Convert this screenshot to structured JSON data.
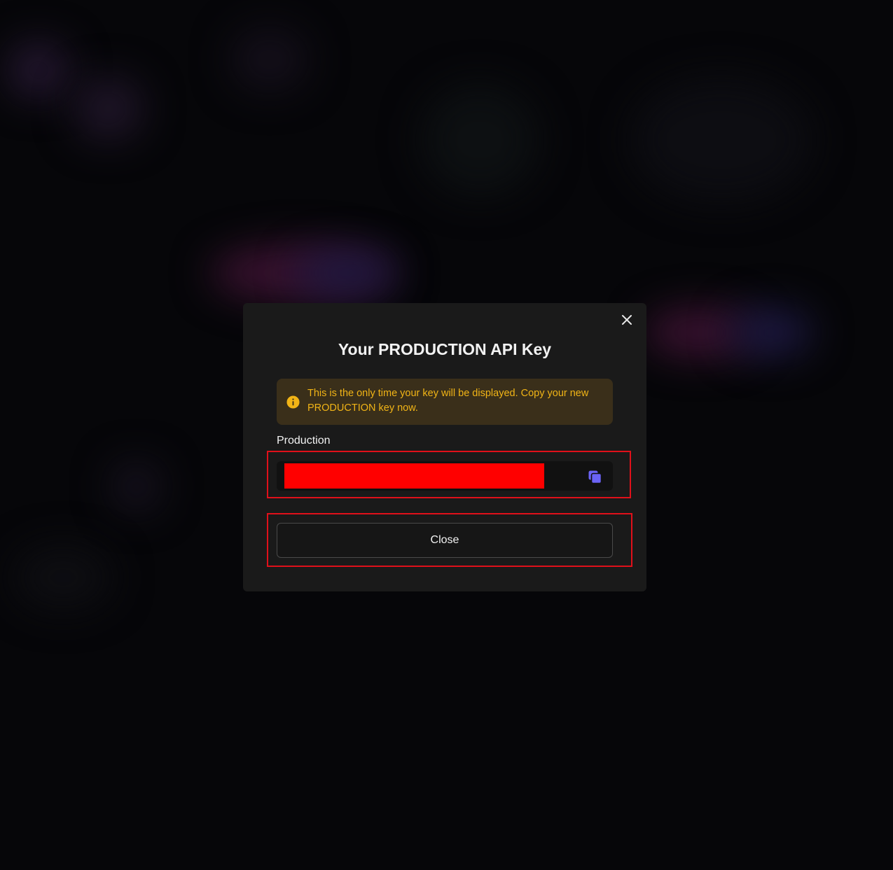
{
  "modal": {
    "title": "Your PRODUCTION API Key",
    "close_icon": "close-icon",
    "warning": {
      "icon": "info-icon",
      "text": "This is the only time your key will be displayed. Copy your new PRODUCTION key now."
    },
    "field": {
      "label": "Production",
      "value": "",
      "copy_icon": "copy-icon"
    },
    "close_button_label": "Close"
  },
  "colors": {
    "modal_bg": "#1a1a1a",
    "warning_bg": "#3a2f1a",
    "warning_text": "#f1b416",
    "copy_icon": "#6b63f5",
    "annotation_border": "#e0101a",
    "redaction": "#ff0000"
  }
}
